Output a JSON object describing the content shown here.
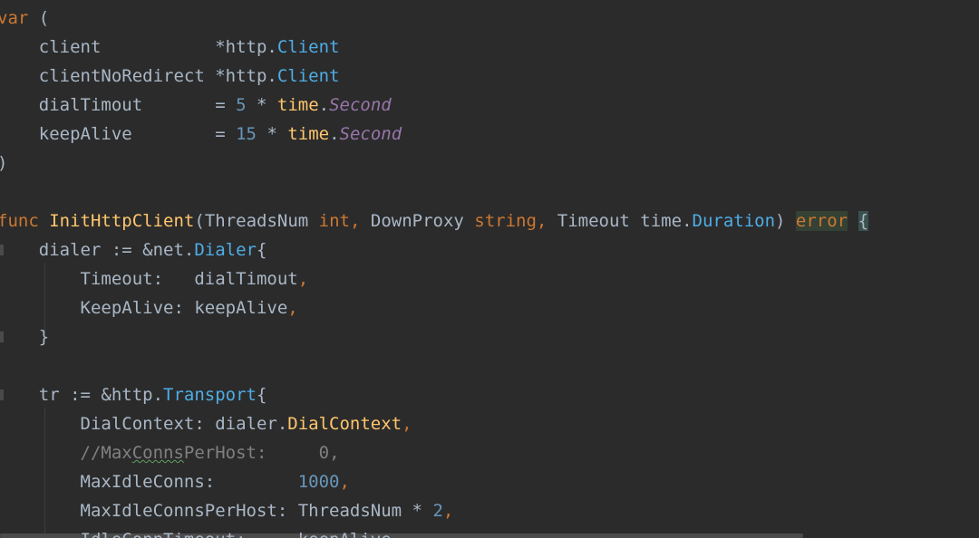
{
  "code_lines": [
    [
      {
        "text": "var",
        "type": "keyword"
      },
      {
        "text": " (",
        "type": "plain"
      }
    ],
    [
      {
        "text": "    client           ",
        "type": "plain"
      },
      {
        "text": "*http.",
        "type": "plain"
      },
      {
        "text": "Client",
        "type": "type"
      }
    ],
    [
      {
        "text": "    clientNoRedirect ",
        "type": "plain"
      },
      {
        "text": "*http.",
        "type": "plain"
      },
      {
        "text": "Client",
        "type": "type"
      }
    ],
    [
      {
        "text": "    dialTimout       ",
        "type": "plain"
      },
      {
        "text": "= ",
        "type": "plain"
      },
      {
        "text": "5",
        "type": "number"
      },
      {
        "text": " * ",
        "type": "plain"
      },
      {
        "text": "time",
        "type": "func"
      },
      {
        "text": ".",
        "type": "plain"
      },
      {
        "text": "Second",
        "type": "italic"
      }
    ],
    [
      {
        "text": "    keepAlive        ",
        "type": "plain"
      },
      {
        "text": "= ",
        "type": "plain"
      },
      {
        "text": "15",
        "type": "number"
      },
      {
        "text": " * ",
        "type": "plain"
      },
      {
        "text": "time",
        "type": "func"
      },
      {
        "text": ".",
        "type": "plain"
      },
      {
        "text": "Second",
        "type": "italic"
      }
    ],
    [
      {
        "text": ")",
        "type": "plain"
      }
    ],
    [],
    [
      {
        "text": "func",
        "type": "keyword"
      },
      {
        "text": " ",
        "type": "plain"
      },
      {
        "text": "InitHttpClient",
        "type": "func"
      },
      {
        "text": "(ThreadsNum ",
        "type": "plain"
      },
      {
        "text": "int",
        "type": "keyword"
      },
      {
        "text": ", ",
        "type": "keyword"
      },
      {
        "text": "DownProxy ",
        "type": "plain"
      },
      {
        "text": "string",
        "type": "keyword"
      },
      {
        "text": ", ",
        "type": "keyword"
      },
      {
        "text": "Timeout time.",
        "type": "plain"
      },
      {
        "text": "Duration",
        "type": "type"
      },
      {
        "text": ") ",
        "type": "plain"
      },
      {
        "text": "error",
        "type": "error_hl"
      },
      {
        "text": " ",
        "type": "plain"
      },
      {
        "text": "{",
        "type": "bracket_hl"
      }
    ],
    [
      {
        "text": "    dialer := &net.",
        "type": "plain"
      },
      {
        "text": "Dialer",
        "type": "type"
      },
      {
        "text": "{",
        "type": "plain"
      }
    ],
    [
      {
        "text": "        Timeout:   dialTimout",
        "type": "plain"
      },
      {
        "text": ",",
        "type": "keyword"
      }
    ],
    [
      {
        "text": "        KeepAlive: keepAlive",
        "type": "plain"
      },
      {
        "text": ",",
        "type": "keyword"
      }
    ],
    [
      {
        "text": "    }",
        "type": "plain"
      }
    ],
    [],
    [
      {
        "text": "    tr := &http.",
        "type": "plain"
      },
      {
        "text": "Transport",
        "type": "type"
      },
      {
        "text": "{",
        "type": "plain"
      }
    ],
    [
      {
        "text": "        DialContext: dialer.",
        "type": "plain"
      },
      {
        "text": "DialContext",
        "type": "func"
      },
      {
        "text": ",",
        "type": "keyword"
      }
    ],
    [
      {
        "text": "        //Max",
        "type": "comment"
      },
      {
        "text": "Conns",
        "type": "comment_typo"
      },
      {
        "text": "PerHost:     0,",
        "type": "comment"
      }
    ],
    [
      {
        "text": "        MaxIdleConns:        ",
        "type": "plain"
      },
      {
        "text": "1000",
        "type": "number"
      },
      {
        "text": ",",
        "type": "keyword"
      }
    ],
    [
      {
        "text": "        MaxIdleConnsPerHost: ThreadsNum * ",
        "type": "plain"
      },
      {
        "text": "2",
        "type": "number"
      },
      {
        "text": ",",
        "type": "keyword"
      }
    ],
    [
      {
        "text": "        IdleConnTimeout:     keepAlive",
        "type": "plain"
      }
    ]
  ],
  "colors": {
    "background": "#2b2b2b",
    "plain": "#a9b7c6",
    "keyword": "#cc7832",
    "func": "#ffc66d",
    "number": "#6897bb",
    "type": "#4eade5",
    "italic": "#9876aa",
    "comment": "#808080"
  }
}
